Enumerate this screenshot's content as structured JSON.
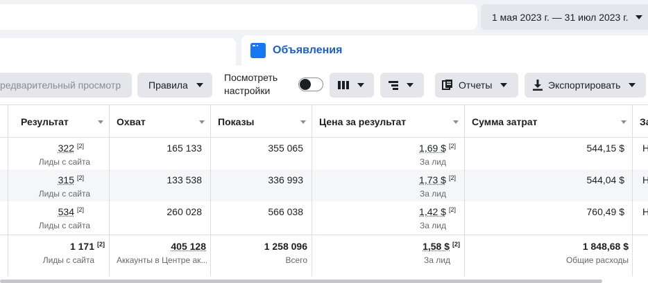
{
  "header": {
    "date_range": "1 мая 2023 г. — 31 июл 2023 г."
  },
  "tabs": {
    "ads_label": "Объявления"
  },
  "toolbar": {
    "preview_label": "редварительный просмотр",
    "rules_label": "Правила",
    "view_settings_line1": "Посмотреть",
    "view_settings_line2": "настройки",
    "reports_label": "Отчеты",
    "export_label": "Экспортировать"
  },
  "table": {
    "columns": [
      "Результат",
      "Охват",
      "Показы",
      "Цена за результат",
      "Сумма затрат",
      "За"
    ],
    "rows": [
      {
        "result": "322",
        "result_note": "[2]",
        "result_sub": "Лиды с сайта",
        "reach": "165 133",
        "impressions": "355 065",
        "cpr": "1,69 $",
        "cpr_note": "[2]",
        "cpr_sub": "За лид",
        "spend": "544,15 $",
        "extra": "Н"
      },
      {
        "result": "315",
        "result_note": "[2]",
        "result_sub": "Лиды с сайта",
        "reach": "133 538",
        "impressions": "336 993",
        "cpr": "1,73 $",
        "cpr_note": "[2]",
        "cpr_sub": "За лид",
        "spend": "544,04 $",
        "extra": "Н"
      },
      {
        "result": "534",
        "result_note": "[2]",
        "result_sub": "Лиды с сайта",
        "reach": "260 028",
        "impressions": "566 038",
        "cpr": "1,42 $",
        "cpr_note": "[2]",
        "cpr_sub": "За лид",
        "spend": "760,49 $",
        "extra": "Н"
      }
    ],
    "totals": {
      "result": "1 171",
      "result_note": "[2]",
      "result_sub": "Лиды с сайта",
      "reach": "405 128",
      "reach_sub": "Аккаунты в Центре ак...",
      "impressions": "1 258 096",
      "impressions_sub": "Всего",
      "cpr": "1,58 $",
      "cpr_note": "[2]",
      "cpr_sub": "За лид",
      "spend": "1 848,68 $",
      "spend_sub": "Общие расходы"
    }
  },
  "colors": {
    "accent": "#1877f2",
    "tab_text": "#1b5fc7",
    "button_bg": "#e4e6eb"
  }
}
